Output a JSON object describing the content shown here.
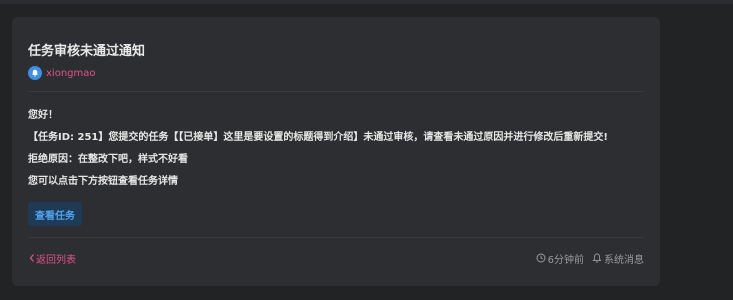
{
  "notification": {
    "title": "任务审核未通过通知",
    "author": "xiongmao",
    "greeting": "您好！",
    "message": "【任务ID: 251】您提交的任务【【已接单】这里是要设置的标题得到介绍】未通过审核，请查看未通过原因并进行修改后重新提交!",
    "reason": "拒绝原因：在整改下吧，样式不好看",
    "hint": "您可以点击下方按钮查看任务详情",
    "view_button": "查看任务"
  },
  "footer": {
    "back_label": "返回列表",
    "time_ago": "6分钟前",
    "category": "系统消息"
  },
  "colors": {
    "accent_pink": "#e0538a",
    "accent_blue": "#4fa3f0",
    "card_bg": "#2d2e31",
    "page_bg": "#222325"
  },
  "icons": [
    "bell-avatar-icon",
    "chevron-left-icon",
    "clock-icon",
    "bell-icon"
  ]
}
